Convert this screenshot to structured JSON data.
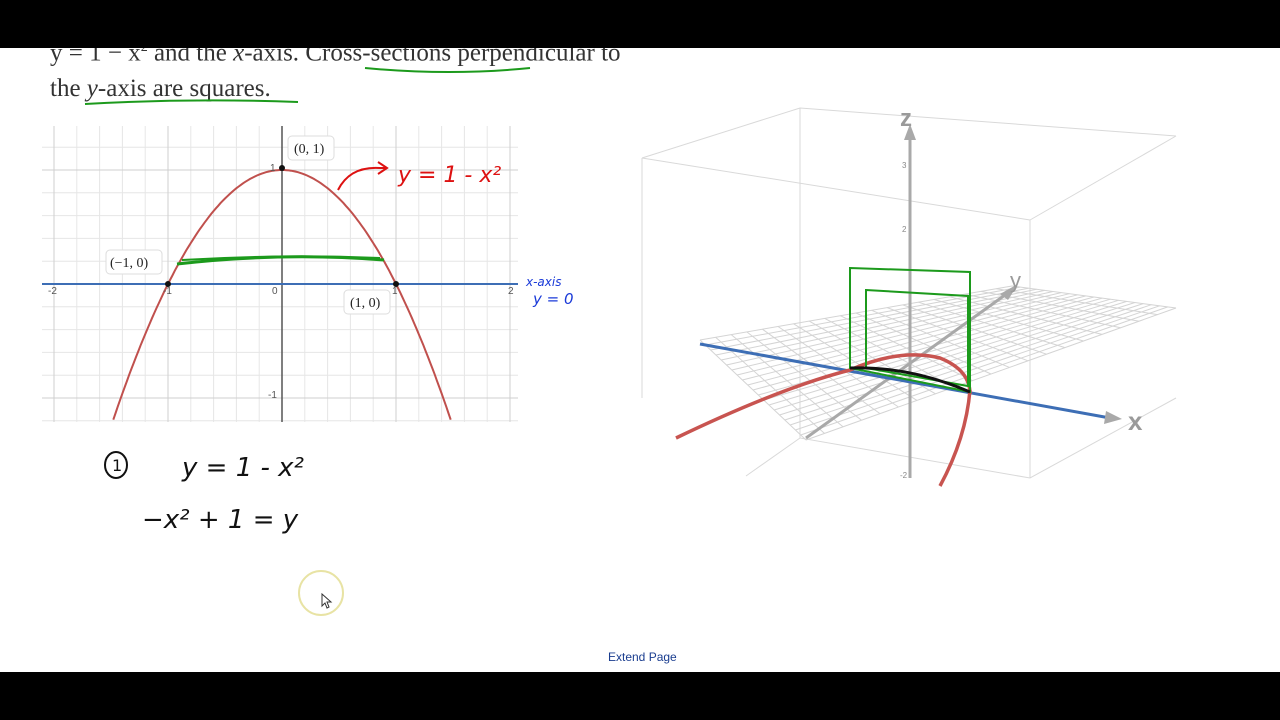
{
  "problem": {
    "line1_a": "y = 1 − x",
    "line1_b": " and the ",
    "line1_c": "x",
    "line1_d": "-axis. ",
    "line1_e": "Cross-sections",
    "line1_f": " perpendicular to",
    "line2_a": "the ",
    "line2_b": "y",
    "line2_c": "-axis are squares."
  },
  "graph2d": {
    "points": {
      "top": "(0, 1)",
      "left": "(−1, 0)",
      "right": "(1, 0)"
    },
    "ticks": {
      "x_neg2": "-2",
      "x_neg1": "-1",
      "x_0": "0",
      "x_1": "1",
      "x_2": "2",
      "y_1": "1",
      "y_neg1": "-1"
    },
    "curve_color": "#c0504d",
    "axis_color": "#3d6eb5",
    "chart_data": {
      "type": "line",
      "series": [
        {
          "name": "y = 1 - x²",
          "x": [
            -2,
            -1.5,
            -1,
            -0.5,
            0,
            0.5,
            1,
            1.5,
            2
          ],
          "y": [
            -3,
            -1.25,
            0,
            0.75,
            1,
            0.75,
            0,
            -1.25,
            -3
          ]
        }
      ],
      "xlim": [
        -2,
        2
      ],
      "ylim": [
        -1,
        1.2
      ]
    }
  },
  "annotations": {
    "curve_label": "y = 1 - x²",
    "xaxis_label": "x-axis",
    "xaxis_eq": "y = 0",
    "step_number": "1",
    "eq1": "y = 1 - x²",
    "eq2": "−x² + 1 = y"
  },
  "graph3d": {
    "axis_z": "z",
    "axis_y": "y",
    "axis_x": "x",
    "tick_z3": "3",
    "tick_z2": "2",
    "tick_zneg2": "-2"
  },
  "footer": {
    "extend_label": "Extend Page"
  }
}
